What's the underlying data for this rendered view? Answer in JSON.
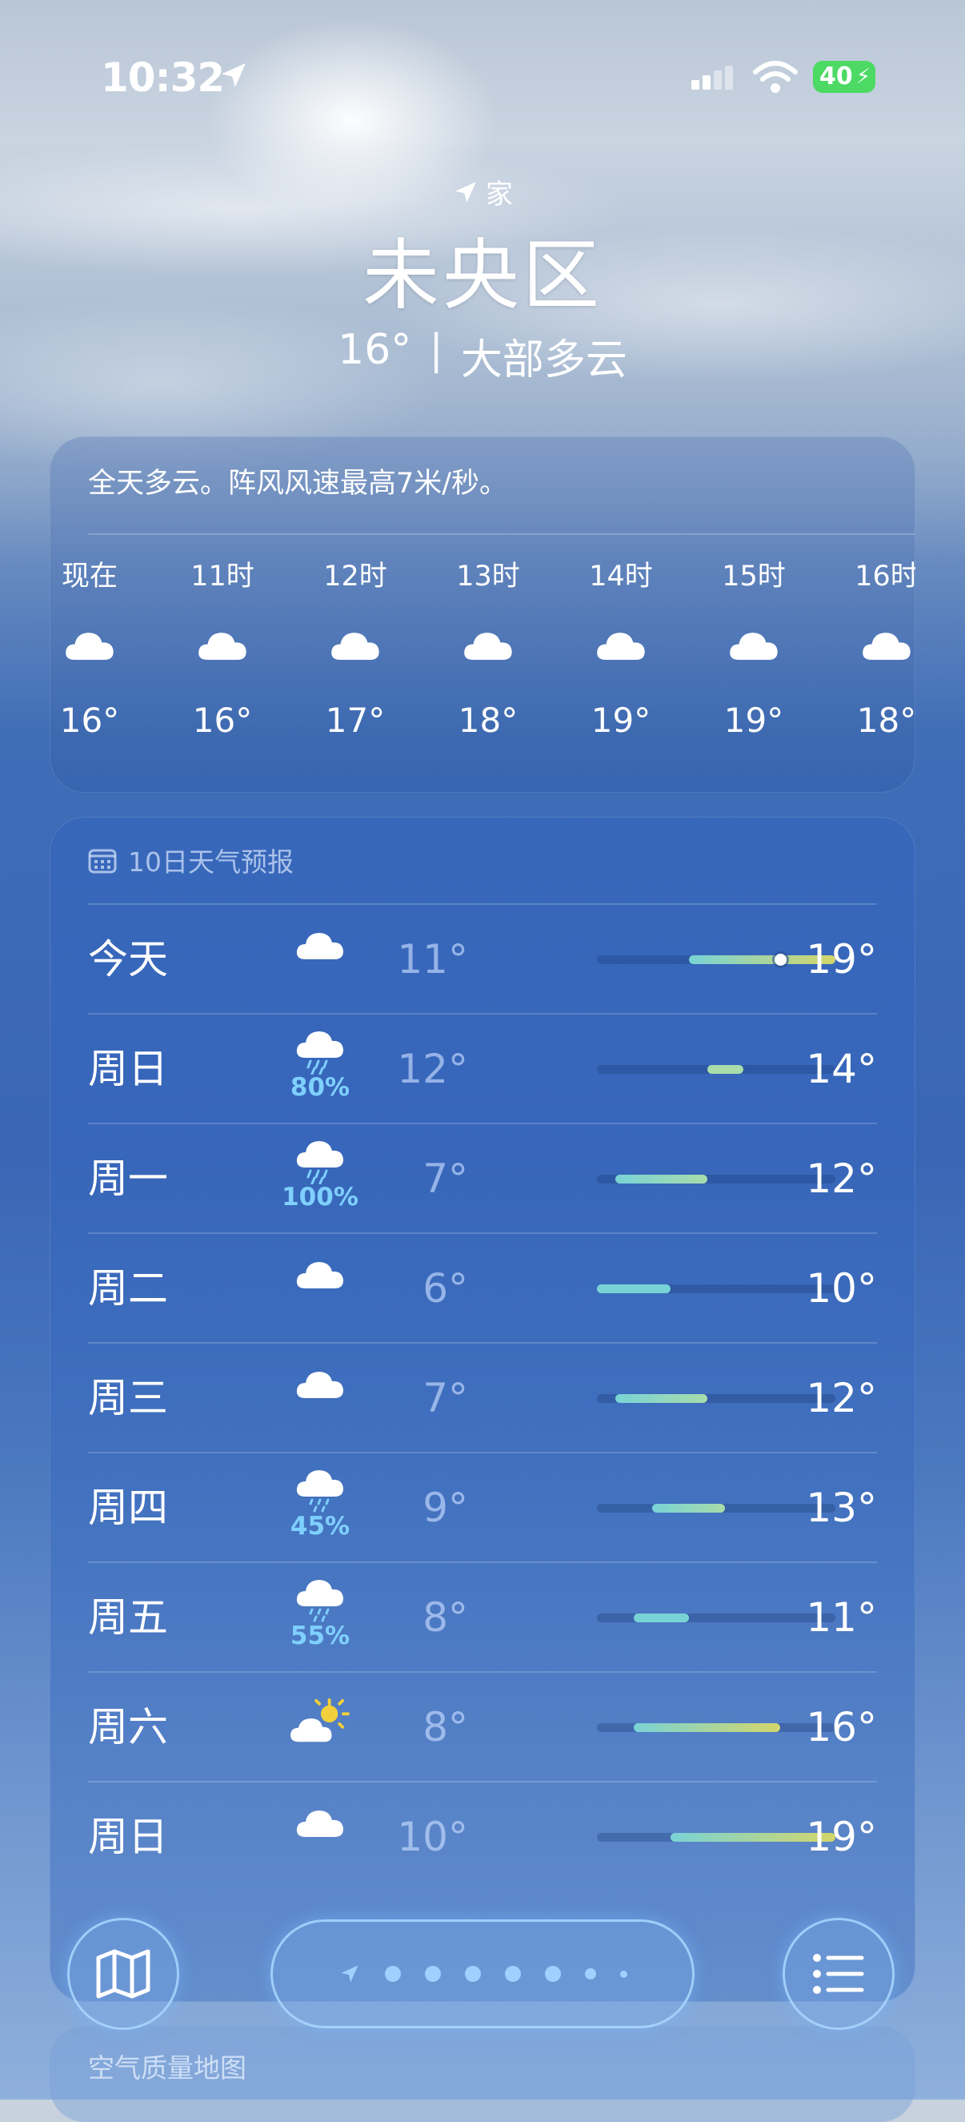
{
  "status_bar": {
    "time": "10:32",
    "battery": "40"
  },
  "header": {
    "home_label": "家",
    "city": "未央区",
    "temperature": "16°",
    "separator": "|",
    "condition": "大部多云"
  },
  "hourly": {
    "summary": "全天多云。阵风风速最高7米/秒。",
    "items": [
      {
        "label": "现在",
        "icon": "cloud-icon",
        "temp": "16°"
      },
      {
        "label": "11时",
        "icon": "cloud-icon",
        "temp": "16°"
      },
      {
        "label": "12时",
        "icon": "cloud-icon",
        "temp": "17°"
      },
      {
        "label": "13时",
        "icon": "cloud-icon",
        "temp": "18°"
      },
      {
        "label": "14时",
        "icon": "cloud-icon",
        "temp": "19°"
      },
      {
        "label": "15时",
        "icon": "cloud-icon",
        "temp": "19°"
      },
      {
        "label": "16时",
        "icon": "cloud-icon",
        "temp": "18°"
      }
    ]
  },
  "daily": {
    "title": "10日天气预报",
    "range_min": 6,
    "range_max": 19,
    "current_temp": 16,
    "days": [
      {
        "day": "今天",
        "icon": "cloud-icon",
        "precip": "",
        "low": "11°",
        "high": "19°",
        "low_v": 11,
        "high_v": 19
      },
      {
        "day": "周日",
        "icon": "cloud-rain-icon",
        "precip": "80%",
        "low": "12°",
        "high": "14°",
        "low_v": 12,
        "high_v": 14
      },
      {
        "day": "周一",
        "icon": "cloud-rain-icon",
        "precip": "100%",
        "low": "7°",
        "high": "12°",
        "low_v": 7,
        "high_v": 12
      },
      {
        "day": "周二",
        "icon": "cloud-icon",
        "precip": "",
        "low": "6°",
        "high": "10°",
        "low_v": 6,
        "high_v": 10
      },
      {
        "day": "周三",
        "icon": "cloud-icon",
        "precip": "",
        "low": "7°",
        "high": "12°",
        "low_v": 7,
        "high_v": 12
      },
      {
        "day": "周四",
        "icon": "cloud-drizzle-icon",
        "precip": "45%",
        "low": "9°",
        "high": "13°",
        "low_v": 9,
        "high_v": 13
      },
      {
        "day": "周五",
        "icon": "cloud-drizzle-icon",
        "precip": "55%",
        "low": "8°",
        "high": "11°",
        "low_v": 8,
        "high_v": 11
      },
      {
        "day": "周六",
        "icon": "partly-sunny-icon",
        "precip": "",
        "low": "8°",
        "high": "16°",
        "low_v": 8,
        "high_v": 16
      },
      {
        "day": "周日",
        "icon": "cloud-icon",
        "precip": "",
        "low": "10°",
        "high": "19°",
        "low_v": 10,
        "high_v": 19
      }
    ]
  },
  "air_quality": {
    "title": "空气质量地图"
  },
  "colors": {
    "cool": "#79d3d6",
    "warm": "#d4d66a",
    "mid": "#a8dcaa"
  }
}
